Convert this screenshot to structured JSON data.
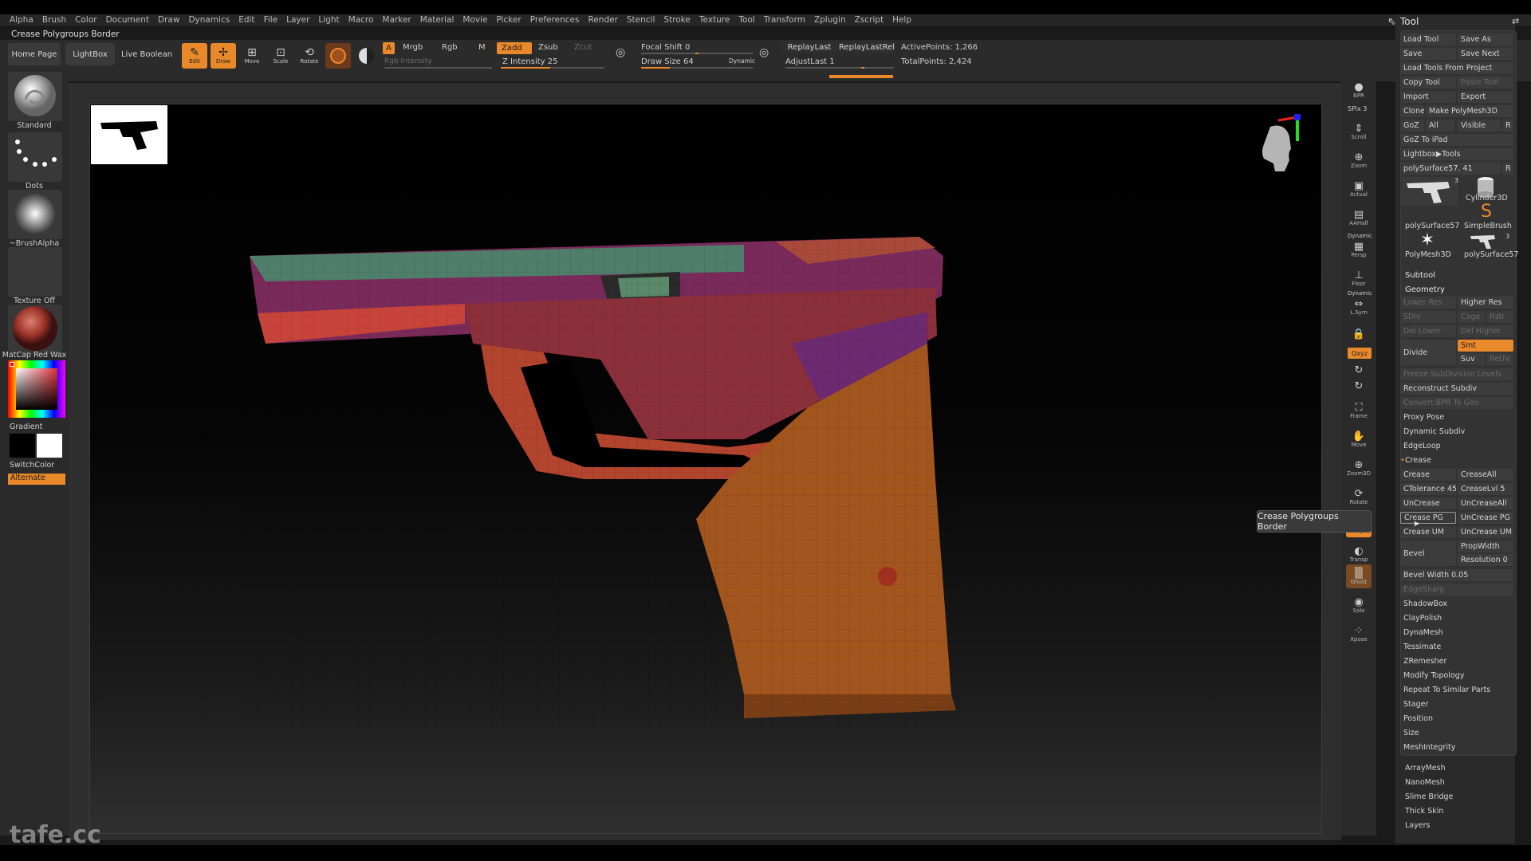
{
  "menubar": {
    "items": [
      "Alpha",
      "Brush",
      "Color",
      "Document",
      "Draw",
      "Dynamics",
      "Edit",
      "File",
      "Layer",
      "Light",
      "Macro",
      "Marker",
      "Material",
      "Movie",
      "Picker",
      "Preferences",
      "Render",
      "Stencil",
      "Stroke",
      "Texture",
      "Tool",
      "Transform",
      "Zplugin",
      "Zscript",
      "Help"
    ]
  },
  "status_title": "Crease Polygroups Border",
  "shelf": {
    "home_page": "Home Page",
    "lightbox": "LightBox",
    "live_boolean": "Live Boolean",
    "edit": "Edit",
    "draw": "Draw",
    "move": "Move",
    "scale": "Scale",
    "rotate": "Rotate",
    "a_label": "A",
    "mrgb": "Mrgb",
    "rgb": "Rgb",
    "m": "M",
    "rgb_intensity": "Rgb Intensity",
    "zadd": "Zadd",
    "zsub": "Zsub",
    "zcut": "Zcut",
    "z_intensity": "Z Intensity 25",
    "focal_shift": "Focal Shift 0",
    "draw_size": "Draw Size 64",
    "dynamic": "Dynamic",
    "replay_last": "ReplayLast",
    "replay_last_rel": "ReplayLastRel",
    "adjust_last": "AdjustLast 1",
    "active_points": "ActivePoints: 1,266",
    "total_points": "TotalPoints: 2,424"
  },
  "left": {
    "standard": "Standard",
    "dots": "Dots",
    "brush_alpha": "~BrushAlpha",
    "texture_off": "Texture Off",
    "matcap": "MatCap Red Wax",
    "gradient": "Gradient",
    "switch_color": "SwitchColor",
    "alternate": "Alternate"
  },
  "rightbar": {
    "bpr": "BPR",
    "spix": "SPix 3",
    "scroll": "Scroll",
    "zoom": "Zoom",
    "actual": "Actual",
    "aahalf": "AAHalf",
    "dynamic": "Dynamic",
    "persp": "Persp",
    "floor": "Floor",
    "dynamic2": "Dynamic",
    "lsym": "L.Sym",
    "xyz": "Qxyz",
    "frame": "Frame",
    "move": "Move",
    "zoom3d": "Zoom3D",
    "rotate": "Rotate",
    "polyf": "PolyF",
    "transp": "Transp",
    "ghost": "Ghost",
    "solo": "Solo",
    "xpose": "Xpose"
  },
  "tool": {
    "title": "Tool",
    "load_tool": "Load Tool",
    "save_as": "Save As",
    "save": "Save",
    "save_next": "Save Next",
    "load_from_project": "Load Tools From Project",
    "copy_tool": "Copy Tool",
    "paste_tool": "Paste Tool",
    "import": "Import",
    "export": "Export",
    "clone": "Clone",
    "make_polymesh": "Make PolyMesh3D",
    "goz": "GoZ",
    "all": "All",
    "visible": "Visible",
    "r": "R",
    "goz_ipad": "GoZ To iPad",
    "lightbox_tools": "Lightbox▶Tools",
    "current_tool": "polySurface57. 41",
    "thumbs": [
      {
        "name": "polySurface57",
        "count": "3"
      },
      {
        "name": "Cylinder3D",
        "count": ""
      },
      {
        "name": "SimpleBrush",
        "count": ""
      },
      {
        "name": "PolyMesh3D",
        "count": ""
      },
      {
        "name": "polySurface57",
        "count": "3"
      }
    ],
    "subtool": "Subtool",
    "geometry": "Geometry",
    "lower_res": "Lower Res",
    "higher_res": "Higher Res",
    "sdiv": "SDiv",
    "cage": "Cage",
    "rstr": "Rstr",
    "del_lower": "Del Lower",
    "del_higher": "Del Higher",
    "divide": "Divide",
    "smt": "Smt",
    "suv": "Suv",
    "reuv": "ReUV",
    "freeze_subdiv": "Freeze SubDivision Levels",
    "reconstruct_subdiv": "Reconstruct Subdiv",
    "convert_bpr": "Convert BPR To Geo",
    "proxy_pose": "Proxy Pose",
    "dynamic_subdiv": "Dynamic Subdiv",
    "edgeloop": "EdgeLoop",
    "crease_section": "Crease",
    "crease": "Crease",
    "crease_all": "CreaseAll",
    "ctolerance": "CTolerance 45",
    "crease_lvl": "CreaseLvl 5",
    "uncrease": "UnCrease",
    "uncrease_all": "UnCreaseAll",
    "crease_pg": "Crease PG",
    "uncrease_pg": "UnCrease PG",
    "crease_um": "Crease UM",
    "uncrease_um": "UnCrease UM",
    "bevel": "Bevel",
    "propwidth": "PropWidth",
    "resolution": "Resolution 0",
    "bevel_width": "Bevel Width 0.05",
    "edgesharp": "EdgeSharp",
    "shadowbox": "ShadowBox",
    "claypolish": "ClayPolish",
    "dynamesh": "DynaMesh",
    "tessimate": "Tessimate",
    "zremesher": "ZRemesher",
    "modify_topology": "Modify Topology",
    "repeat_similar": "Repeat To Similar Parts",
    "stager": "Stager",
    "position": "Position",
    "size": "Size",
    "meshintegrity": "MeshIntegrity",
    "arraymesh": "ArrayMesh",
    "nanomesh": "NanoMesh",
    "slime_bridge": "Slime Bridge",
    "thick_skin": "Thick Skin",
    "layers": "Layers"
  },
  "tooltip": "Crease Polygroups Border",
  "watermark": "tafe.cc",
  "colors": {
    "accent": "#e9892a",
    "panel": "#2a2a2a",
    "button": "#3c3c3c"
  }
}
